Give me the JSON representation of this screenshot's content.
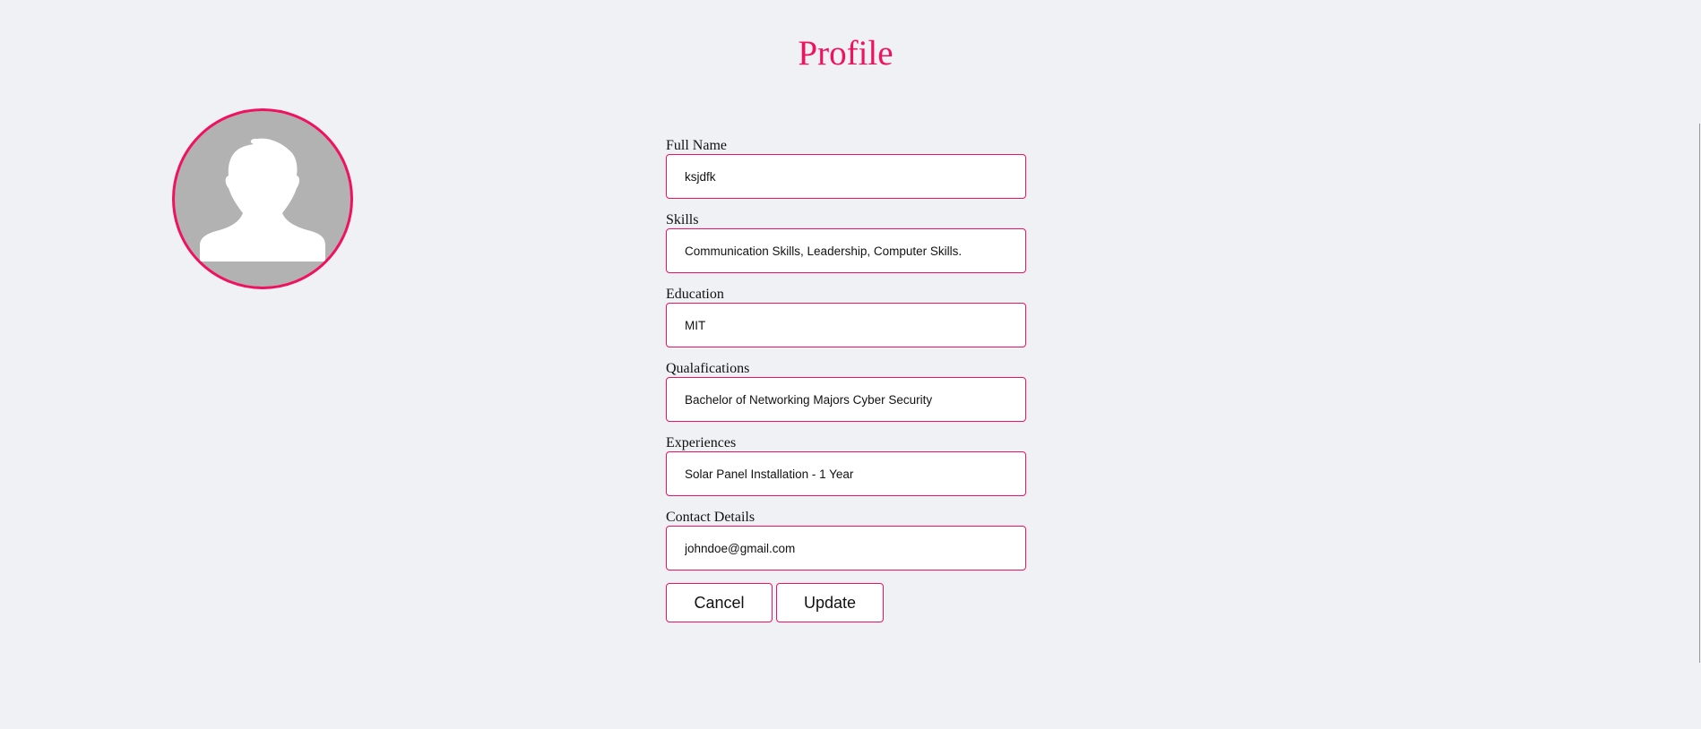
{
  "page": {
    "title": "Profile"
  },
  "avatar": {
    "icon": "user-silhouette-icon",
    "border_color": "#f0115f",
    "fill_color": "#b2b2b2"
  },
  "form": {
    "fields": [
      {
        "label": "Full Name",
        "value": "ksjdfk"
      },
      {
        "label": "Skills",
        "value": "Communication Skills, Leadership, Computer Skills."
      },
      {
        "label": "Education",
        "value": "MIT"
      },
      {
        "label": "Qualafications",
        "value": "Bachelor of Networking Majors Cyber Security"
      },
      {
        "label": "Experiences",
        "value": "Solar Panel Installation - 1 Year"
      },
      {
        "label": "Contact Details",
        "value": "johndoe@gmail.com"
      }
    ],
    "cancel_label": "Cancel",
    "update_label": "Update"
  },
  "colors": {
    "accent": "#f0115f",
    "background": "#f0f1f5"
  }
}
